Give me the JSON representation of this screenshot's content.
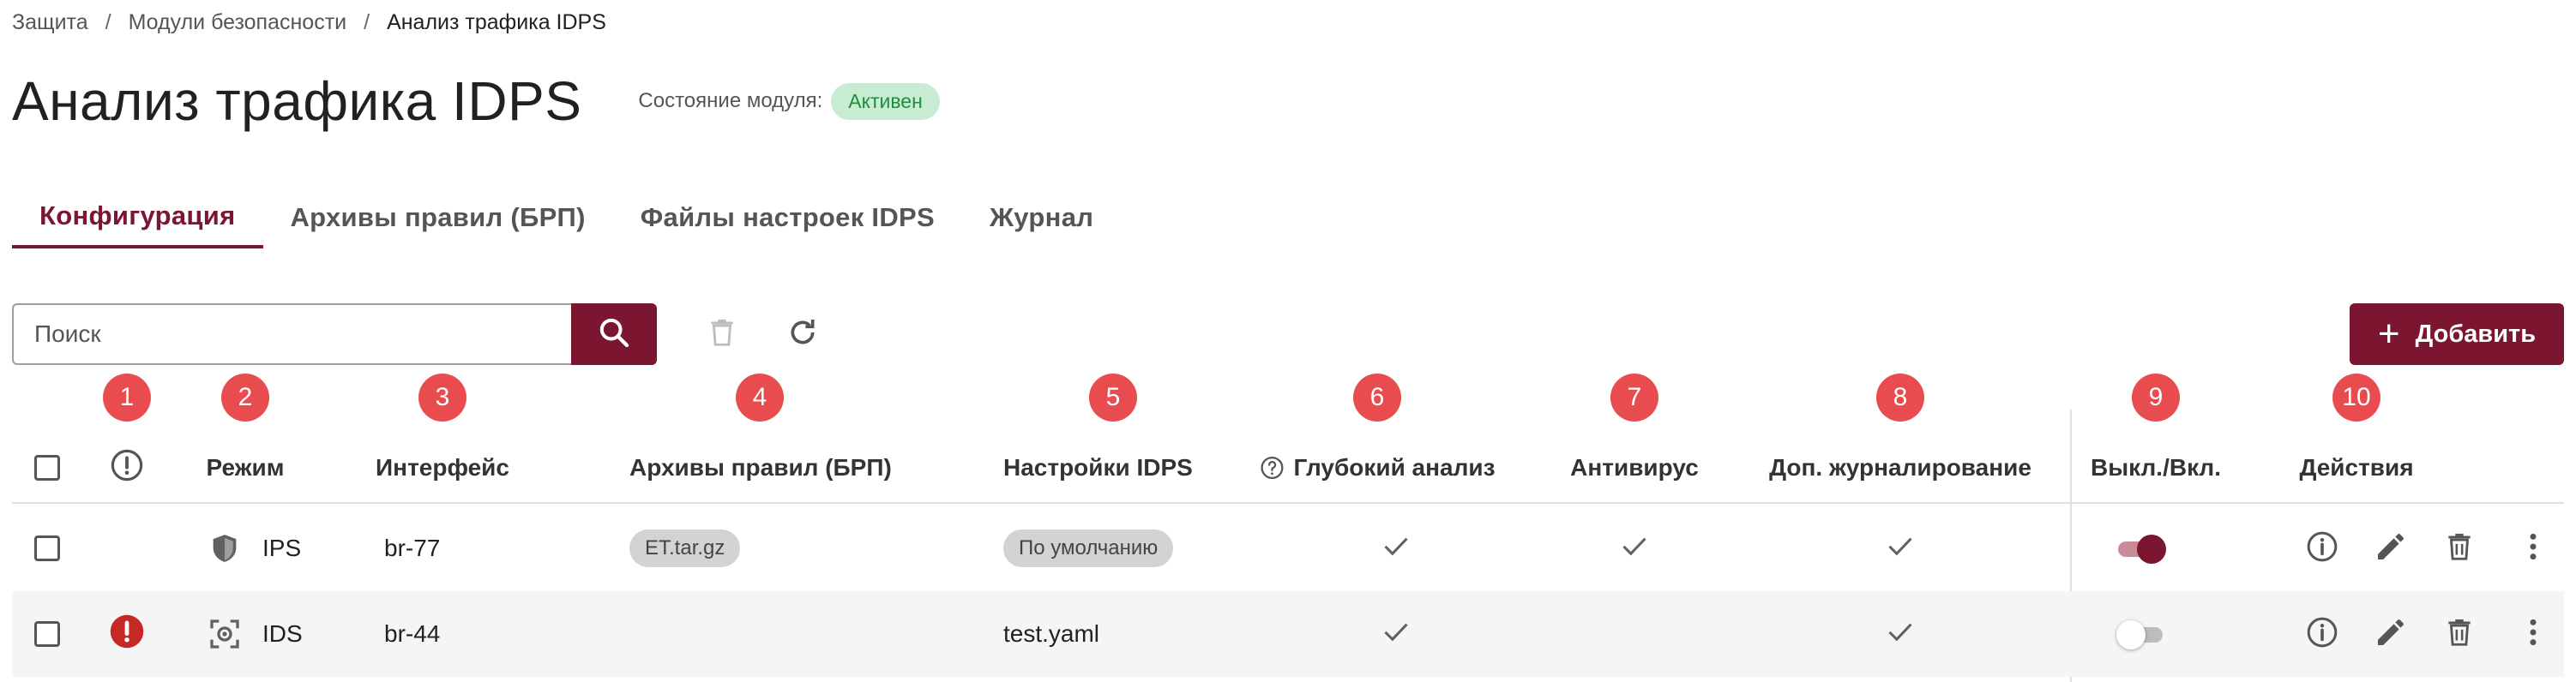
{
  "breadcrumb": {
    "items": [
      "Защита",
      "Модули безопасности",
      "Анализ трафика IDPS"
    ],
    "separator": "/"
  },
  "header": {
    "title": "Анализ трафика IDPS",
    "status_label": "Состояние модуля:",
    "status_value": "Активен"
  },
  "tabs": [
    {
      "label": "Конфигурация",
      "active": true
    },
    {
      "label": "Архивы правил (БРП)",
      "active": false
    },
    {
      "label": "Файлы настроек IDPS",
      "active": false
    },
    {
      "label": "Журнал",
      "active": false
    }
  ],
  "toolbar": {
    "search_placeholder": "Поиск",
    "search_icon": "search-icon",
    "delete_icon": "trash-icon",
    "refresh_icon": "refresh-icon",
    "add_label": "Добавить"
  },
  "markers": [
    "1",
    "2",
    "3",
    "4",
    "5",
    "6",
    "7",
    "8",
    "9",
    "10"
  ],
  "table": {
    "columns": {
      "alert": "alert-circle-icon",
      "mode": "Режим",
      "interface": "Интерфейс",
      "rule_archives": "Архивы правил (БРП)",
      "idps_settings": "Настройки IDPS",
      "deep_analysis": "Глубокий анализ",
      "antivirus": "Антивирус",
      "extra_logging": "Доп. журналирование",
      "enabled": "Выкл./Вкл.",
      "actions": "Действия"
    },
    "rows": [
      {
        "alert": false,
        "mode": "IPS",
        "mode_icon": "shield-icon",
        "interface": "br-77",
        "rule_archive": "ET.tar.gz",
        "idps_settings": "По умолчанию",
        "idps_settings_chip": true,
        "deep_analysis": true,
        "antivirus": true,
        "extra_logging": true,
        "enabled": true
      },
      {
        "alert": true,
        "mode": "IDS",
        "mode_icon": "scan-eye-icon",
        "interface": "br-44",
        "rule_archive": "",
        "idps_settings": "test.yaml",
        "idps_settings_chip": false,
        "deep_analysis": true,
        "antivirus": false,
        "extra_logging": true,
        "enabled": false
      }
    ]
  },
  "colors": {
    "brand": "#7b1530",
    "marker": "#e84c4f",
    "status_bg": "#c8ecd1",
    "status_text": "#1e8e3e",
    "alert": "#c62828",
    "chip_bg": "#d3d3d3"
  }
}
